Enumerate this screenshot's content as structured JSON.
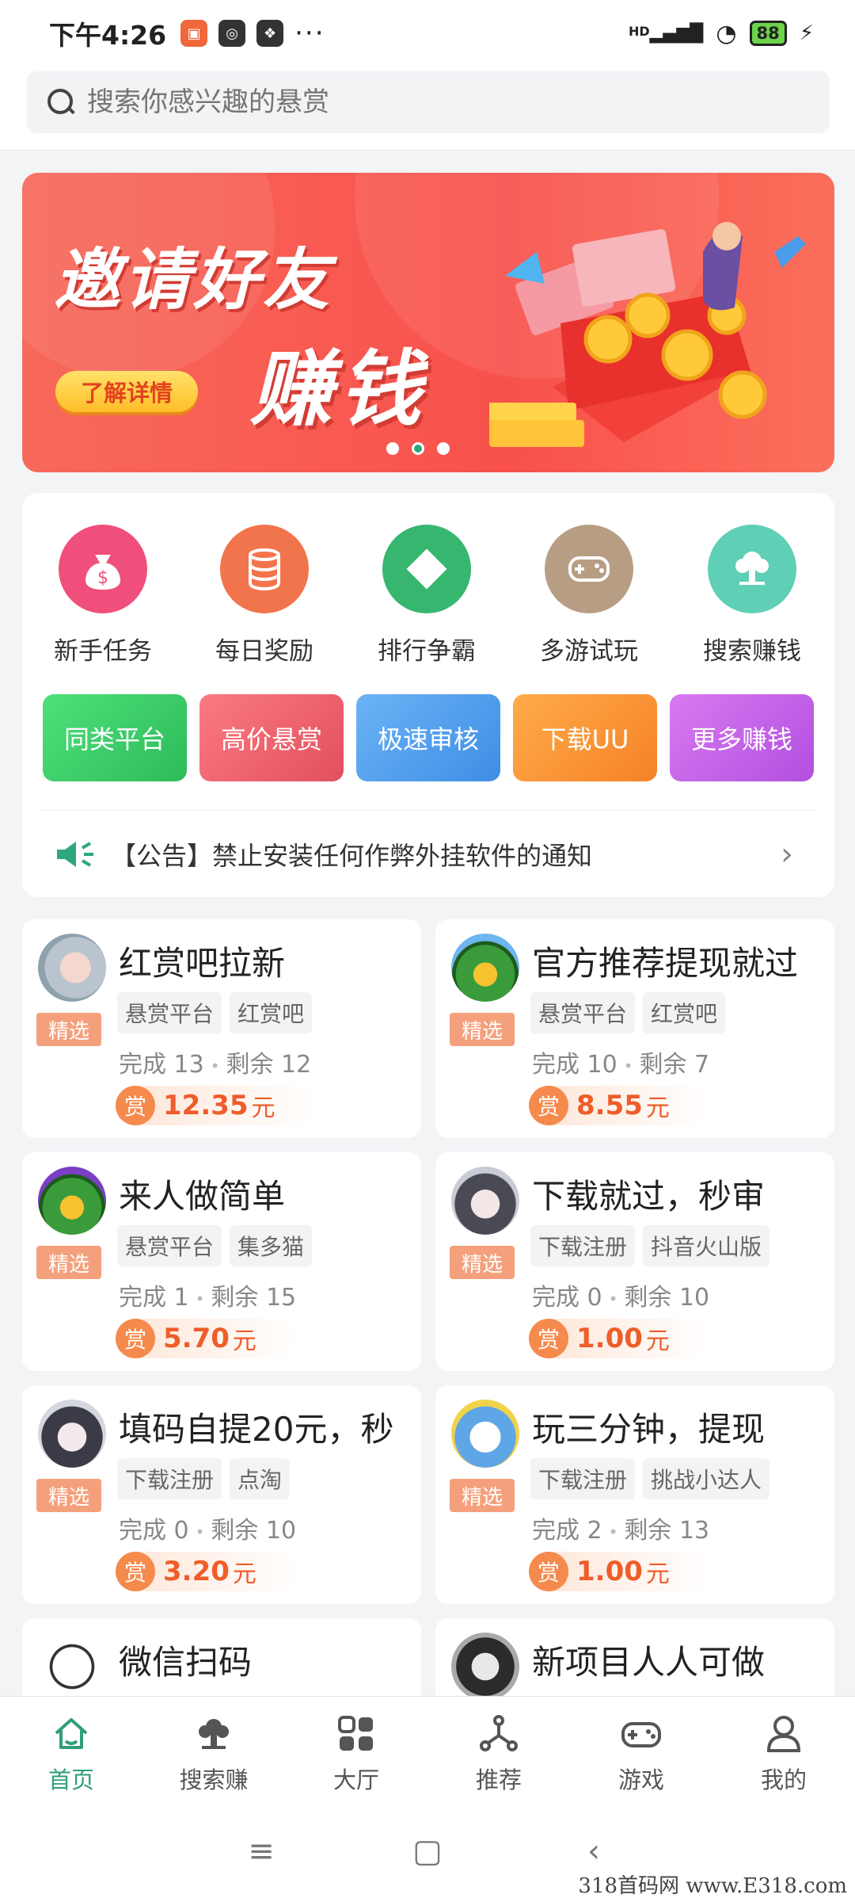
{
  "status_bar": {
    "time": "下午4:26",
    "network": "HD",
    "battery": "88"
  },
  "search": {
    "placeholder": "搜索你感兴趣的悬赏"
  },
  "banner": {
    "line1": "邀请好友",
    "line2": "赚钱",
    "button": "了解详情"
  },
  "features": [
    {
      "label": "新手任务",
      "icon": "money-bag-icon",
      "color": "#ef4f7a"
    },
    {
      "label": "每日奖励",
      "icon": "coins-stack-icon",
      "color": "#f2744c"
    },
    {
      "label": "排行争霸",
      "icon": "diamond-icon",
      "color": "#37b66f"
    },
    {
      "label": "多游试玩",
      "icon": "gamepad-icon",
      "color": "#b89d85"
    },
    {
      "label": "搜索赚钱",
      "icon": "search-earn-icon",
      "color": "#5fcfb6"
    }
  ],
  "pills": [
    {
      "label": "同类平台",
      "color1": "#4ee07a",
      "color2": "#2dbb5a"
    },
    {
      "label": "高价悬赏",
      "color1": "#fb7a82",
      "color2": "#e2505d"
    },
    {
      "label": "极速审核",
      "color1": "#6bb3f5",
      "color2": "#3f8de6"
    },
    {
      "label": "下载UU",
      "color1": "#ffab4a",
      "color2": "#f58226"
    },
    {
      "label": "更多赚钱",
      "color1": "#d87af0",
      "color2": "#b24fe0"
    }
  ],
  "notice": {
    "text": "【公告】禁止安装任何作弊外挂软件的通知"
  },
  "tasks": [
    {
      "title": "红赏吧拉新",
      "badge": "精选",
      "tags": [
        "悬赏平台",
        "红赏吧"
      ],
      "done_label": "完成 13",
      "left_label": "剩余 12",
      "reward_icon": "赏",
      "amount": "12.35",
      "unit": "元"
    },
    {
      "title": "官方推荐提现就过",
      "badge": "精选",
      "tags": [
        "悬赏平台",
        "红赏吧"
      ],
      "done_label": "完成 10",
      "left_label": "剩余 7",
      "reward_icon": "赏",
      "amount": "8.55",
      "unit": "元"
    },
    {
      "title": "来人做简单",
      "badge": "精选",
      "tags": [
        "悬赏平台",
        "集多猫"
      ],
      "done_label": "完成 1",
      "left_label": "剩余 15",
      "reward_icon": "赏",
      "amount": "5.70",
      "unit": "元"
    },
    {
      "title": "下载就过，秒审",
      "badge": "精选",
      "tags": [
        "下载注册",
        "抖音火山版"
      ],
      "done_label": "完成 0",
      "left_label": "剩余 10",
      "reward_icon": "赏",
      "amount": "1.00",
      "unit": "元"
    },
    {
      "title": "填码自提20元，秒",
      "badge": "精选",
      "tags": [
        "下载注册",
        "点淘"
      ],
      "done_label": "完成 0",
      "left_label": "剩余 10",
      "reward_icon": "赏",
      "amount": "3.20",
      "unit": "元"
    },
    {
      "title": "玩三分钟，提现",
      "badge": "精选",
      "tags": [
        "下载注册",
        "挑战小达人"
      ],
      "done_label": "完成 2",
      "left_label": "剩余 13",
      "reward_icon": "赏",
      "amount": "1.00",
      "unit": "元"
    },
    {
      "title": "微信扫码"
    },
    {
      "title": "新项目人人可做"
    }
  ],
  "bottom_nav": [
    {
      "label": "首页",
      "icon": "home-icon",
      "active": true
    },
    {
      "label": "搜索赚",
      "icon": "search-earn-icon",
      "active": false
    },
    {
      "label": "大厅",
      "icon": "hall-icon",
      "active": false
    },
    {
      "label": "推荐",
      "icon": "share-icon",
      "active": false
    },
    {
      "label": "游戏",
      "icon": "gamepad-icon",
      "active": false
    },
    {
      "label": "我的",
      "icon": "user-icon",
      "active": false
    }
  ],
  "watermark": "318首码网 www.E318.com"
}
